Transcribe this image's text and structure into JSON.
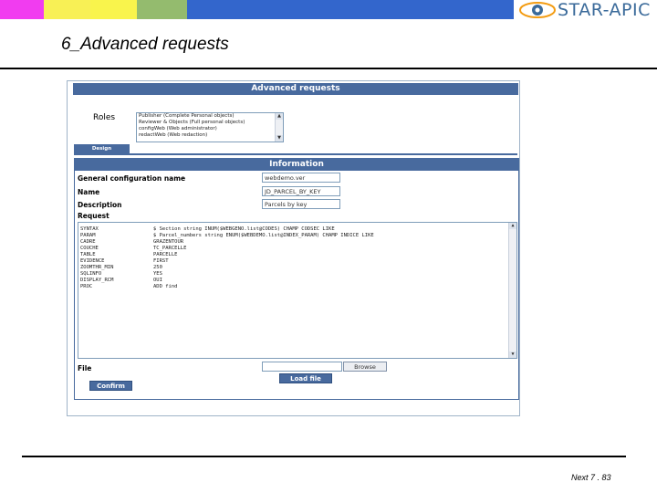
{
  "header": {
    "color_bars": [
      "#f13cf0",
      "#f8f055",
      "#f9f44c",
      "#94bb6e",
      "#3366cc"
    ],
    "logo": {
      "text": "STAR-APIC",
      "color": "#3a6a9a"
    }
  },
  "slide": {
    "title": "6_Advanced requests",
    "footer": "Next 7 . 83"
  },
  "app": {
    "window_title": "Advanced requests",
    "roles": {
      "label": "Roles",
      "options": [
        "Publisher (Complete Personal objects)",
        "Reviewer & Objects (Full personal objects)",
        "configWeb (Web administrator)",
        "redactWeb (Web redaction)"
      ]
    },
    "tab_label": "Design",
    "information": {
      "header": "Information",
      "general_config_label": "General configuration name",
      "general_config_value": "webdemo.ver",
      "name_label": "Name",
      "name_value": "JD_PARCEL_BY_KEY",
      "description_label": "Description",
      "description_value": "Parcels by key",
      "request_label": "Request",
      "request_rows": [
        {
          "key": "SYNTAX",
          "value": "$ Section string INUM($WEBGENO.list@CODES) CHAMP CODSEC LIKE"
        },
        {
          "key": "PARAM",
          "value": "$ Parcel_numbers string ENUM($WEBDEMO.list@INDEX_PARAM) CHAMP INDICE LIKE"
        },
        {
          "key": "CADRE",
          "value": "GRAZENTOUR"
        },
        {
          "key": "COUCHE",
          "value": "TC_PARCELLE"
        },
        {
          "key": "TABLE",
          "value": "PARCELLE"
        },
        {
          "key": "EVIDENCE",
          "value": "FIRST"
        },
        {
          "key": "ZOOMTHR_MIN",
          "value": "250"
        },
        {
          "key": "SQLINFO",
          "value": "YES"
        },
        {
          "key": "DISPLAY_RCM",
          "value": "OUI"
        },
        {
          "key": "PROC",
          "value": "ADD find"
        }
      ],
      "file_label": "File",
      "file_value": "",
      "browse_label": "Browse",
      "load_label": "Load file",
      "confirm_label": "Confirm"
    },
    "colors": {
      "header_blue": "#486a9e",
      "border_blue": "#7f9db9"
    }
  }
}
